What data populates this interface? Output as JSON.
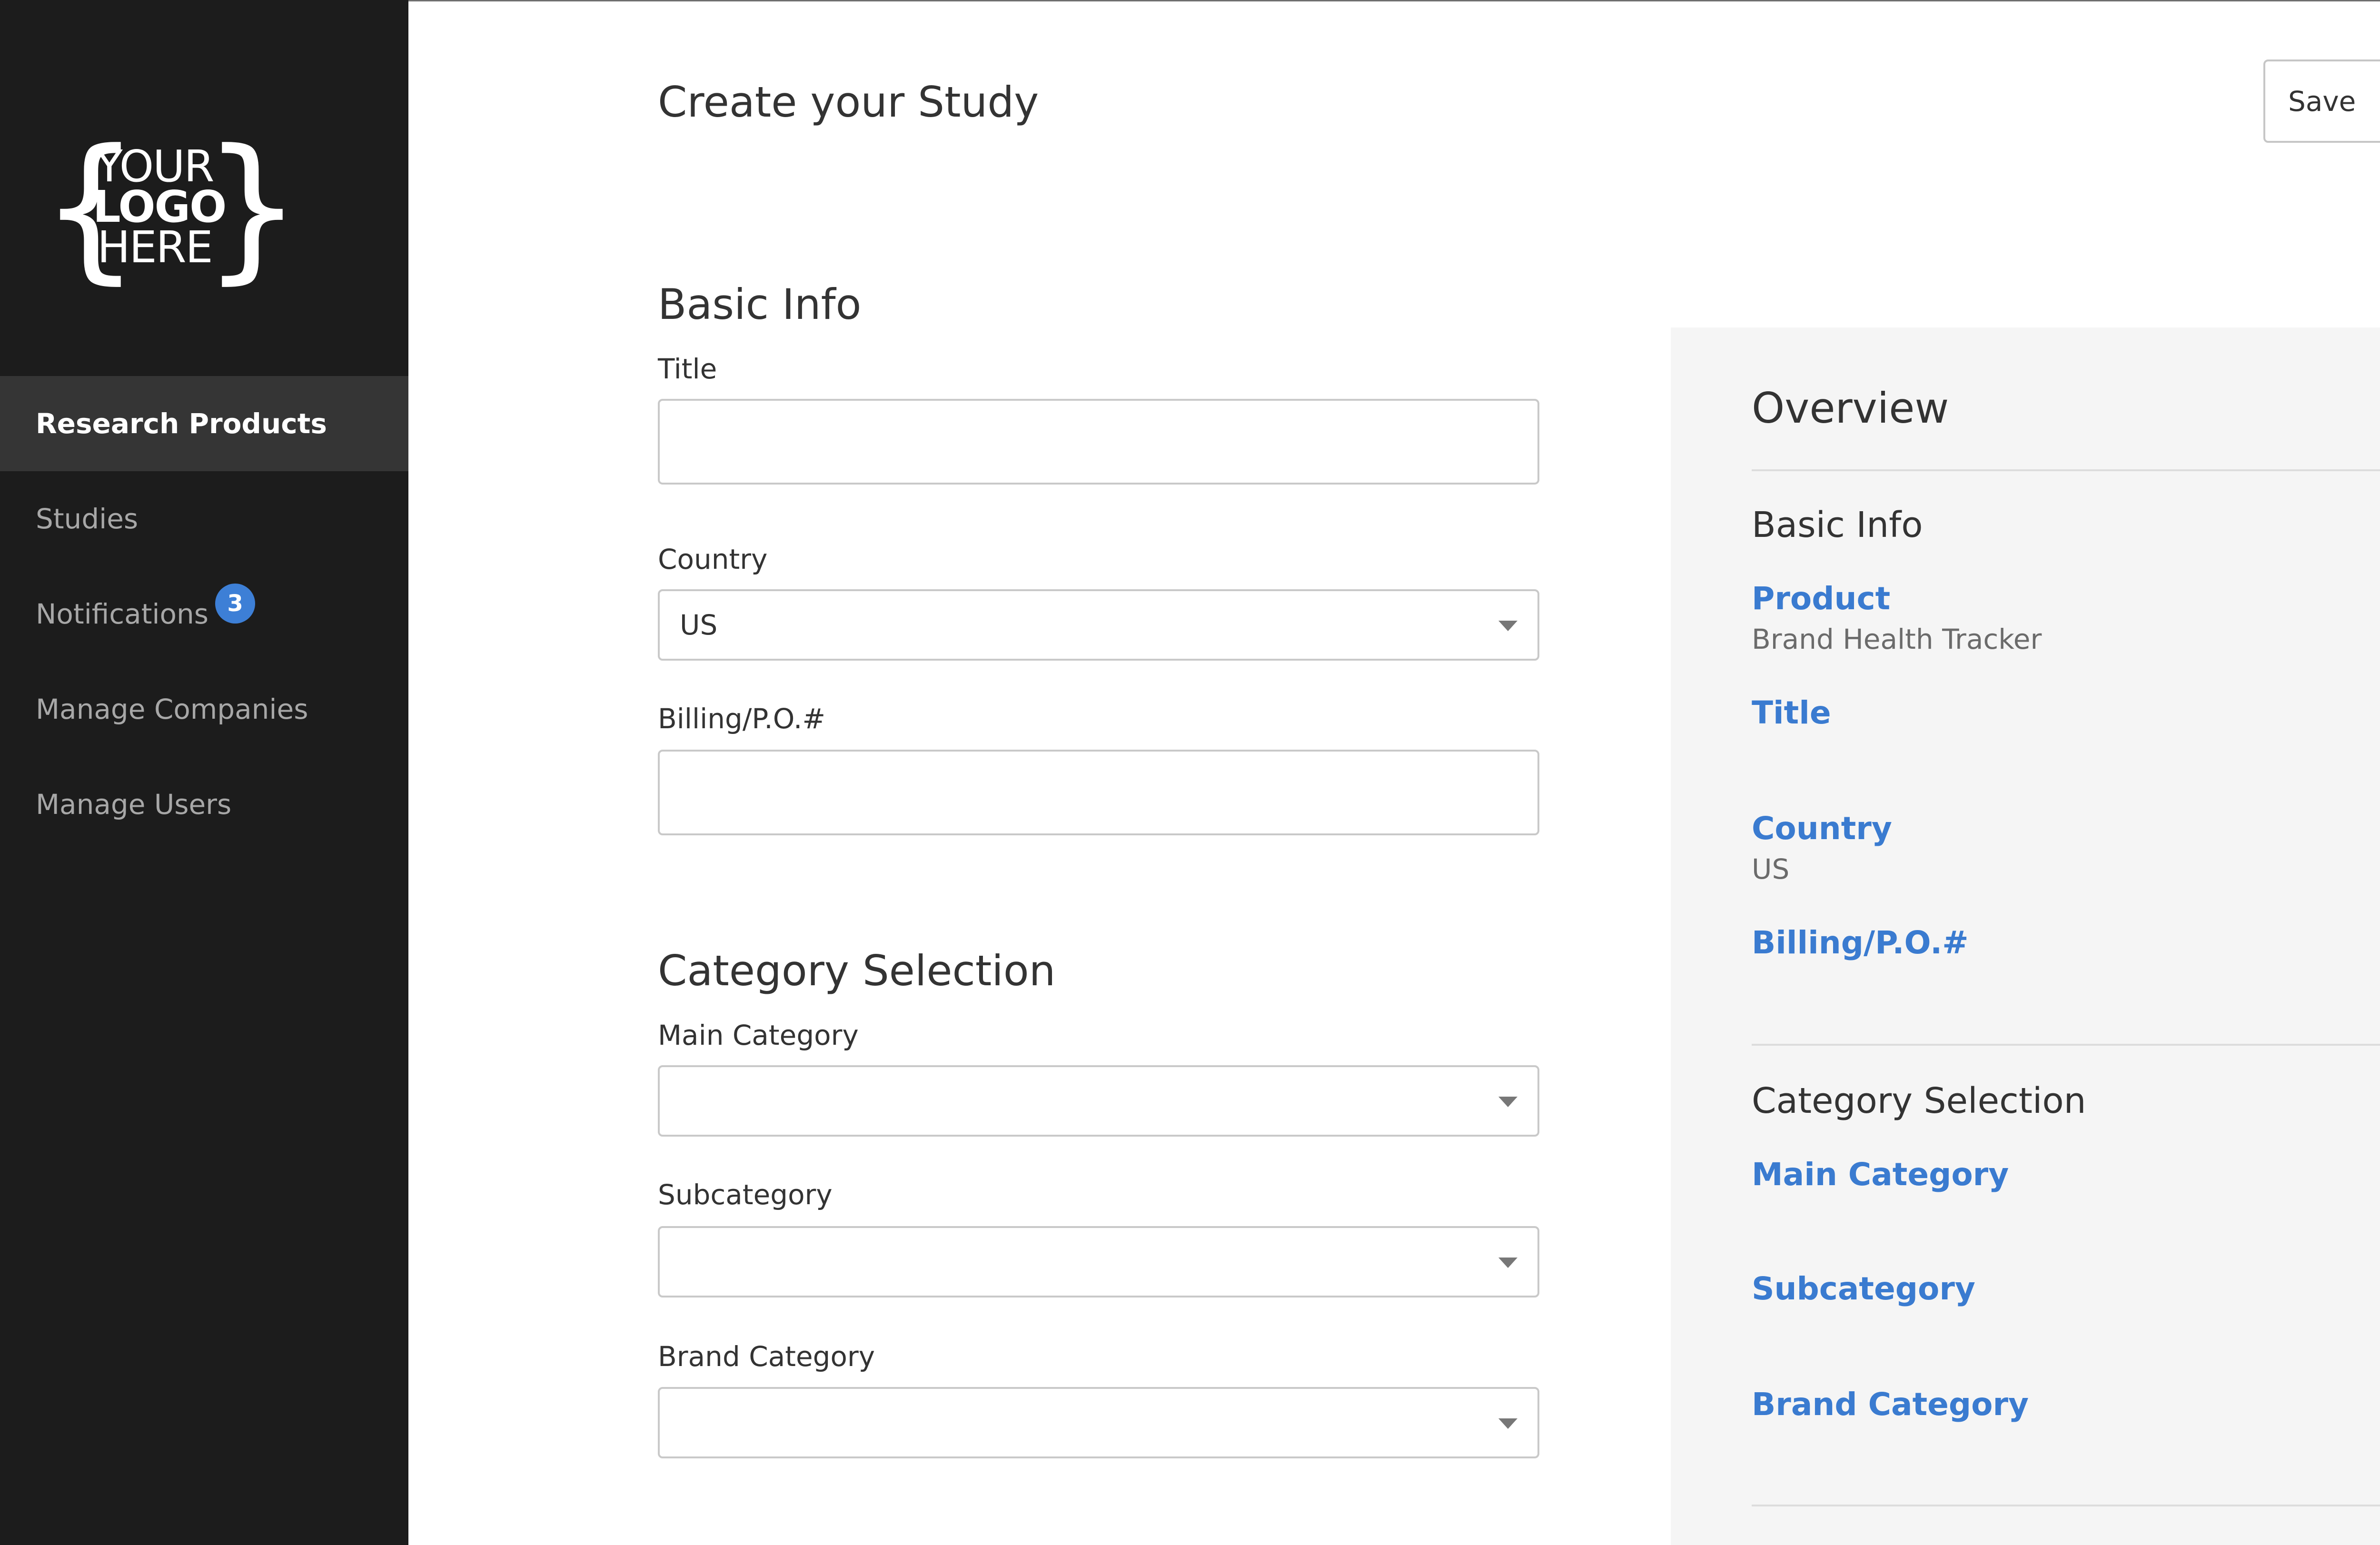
{
  "sidebar": {
    "logo": {
      "line1": "YOUR",
      "line2": "LOGO",
      "line3": "HERE"
    },
    "items": [
      {
        "label": "Research Products",
        "active": true
      },
      {
        "label": "Studies"
      },
      {
        "label": "Notifications",
        "badge": "3"
      },
      {
        "label": "Manage Companies"
      },
      {
        "label": "Manage Users"
      }
    ]
  },
  "header": {
    "title": "Create your Study",
    "save_label": "Save"
  },
  "form": {
    "basic_info": {
      "title": "Basic Info",
      "title_label": "Title",
      "title_value": "",
      "country_label": "Country",
      "country_value": "US",
      "billing_label": "Billing/P.O.#",
      "billing_value": ""
    },
    "category_selection": {
      "title": "Category Selection",
      "main_label": "Main Category",
      "main_value": "",
      "sub_label": "Subcategory",
      "sub_value": "",
      "brand_label": "Brand Category",
      "brand_value": ""
    }
  },
  "overview": {
    "title": "Overview",
    "basic_info": {
      "title": "Basic Info",
      "product_label": "Product",
      "product_value": "Brand Health Tracker",
      "title_label": "Title",
      "country_label": "Country",
      "country_value": "US",
      "billing_label": "Billing/P.O.#"
    },
    "category_selection": {
      "title": "Category Selection",
      "main_label": "Main Category",
      "sub_label": "Subcategory",
      "brand_label": "Brand Category"
    }
  },
  "colors": {
    "sidebar_bg": "#1c1c1c",
    "sidebar_active_bg": "#353535",
    "accent": "#3a7bd0",
    "badge": "#3d7fd6",
    "overview_bg": "#f5f5f5"
  }
}
